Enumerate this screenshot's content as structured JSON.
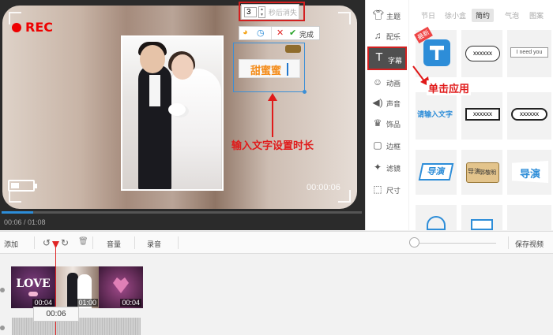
{
  "preview": {
    "rec_label": "REC",
    "timecode": "00:00:06",
    "progress_time": "00:06 / 01:08",
    "progress": 0.088
  },
  "subtitle": {
    "text": "甜蜜蜜",
    "duration_value": "3",
    "duration_label": "秒后消失",
    "done_label": "完成"
  },
  "annotations": {
    "input_hint": "输入文字设置时长",
    "apply_hint": "单击应用"
  },
  "sidebar": {
    "items": [
      {
        "icon": "shirt-icon",
        "label": "主题"
      },
      {
        "icon": "music-icon",
        "label": "配乐"
      },
      {
        "icon": "text-icon",
        "label": "字幕"
      },
      {
        "icon": "animation-icon",
        "label": "动画"
      },
      {
        "icon": "sound-icon",
        "label": "声音"
      },
      {
        "icon": "decoration-icon",
        "label": "饰品"
      },
      {
        "icon": "border-icon",
        "label": "边框"
      },
      {
        "icon": "filter-icon",
        "label": "滤镜"
      },
      {
        "icon": "size-icon",
        "label": "尺寸"
      }
    ]
  },
  "panel": {
    "tabs": [
      "节日",
      "徐小盒",
      "简约",
      "气泡",
      "图案"
    ],
    "active_tab": "简约",
    "tiles": {
      "t1_badge": "最新",
      "t2_text": "xxxxxx",
      "t3_text": "I need you",
      "t4_text": "请输入文字",
      "t5_text": "xxxxxx",
      "t6_text": "xxxxxx",
      "t7_text": "导演",
      "t8_text_a": "导演",
      "t8_text_b": "郭敬明",
      "t9_text": "导演"
    }
  },
  "toolbar": {
    "add_label": "添加",
    "volume_label": "音量",
    "record_label": "录音",
    "save_label": "保存视频"
  },
  "track": {
    "clips": [
      {
        "title": "LOVE",
        "time": "00:04"
      },
      {
        "title": "",
        "time": "01:00"
      },
      {
        "title": "",
        "time": "00:04"
      }
    ],
    "playhead_time": "00:06"
  },
  "colors": {
    "accent_red": "#d32020",
    "accent_blue": "#2d8dd8",
    "subtitle_orange": "#f48a16"
  }
}
